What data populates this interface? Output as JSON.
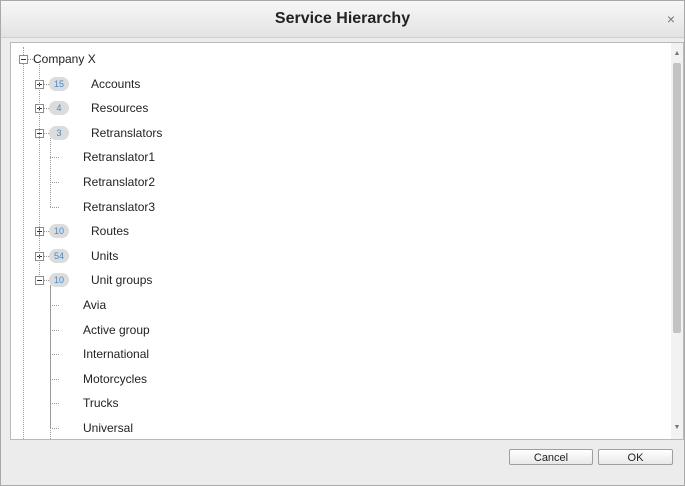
{
  "dialog": {
    "title": "Service Hierarchy",
    "close_label": "×"
  },
  "tree": {
    "root": {
      "label": "Company X",
      "expanded": true
    },
    "groups": [
      {
        "label": "Accounts",
        "count": "15",
        "expanded": false,
        "children": []
      },
      {
        "label": "Resources",
        "count": "4",
        "expanded": false,
        "children": []
      },
      {
        "label": "Retranslators",
        "count": "3",
        "expanded": true,
        "children": [
          "Retranslator1",
          "Retranslator2",
          "Retranslator3"
        ]
      },
      {
        "label": "Routes",
        "count": "10",
        "expanded": false,
        "children": []
      },
      {
        "label": "Units",
        "count": "54",
        "expanded": false,
        "children": []
      },
      {
        "label": "Unit groups",
        "count": "10",
        "expanded": true,
        "children": [
          "Avia",
          "Active group",
          "International",
          "Motorcycles",
          "Trucks",
          "Universal"
        ]
      }
    ]
  },
  "scrollbar": {
    "up_arrow": "▲",
    "down_arrow": "▼"
  },
  "buttons": {
    "cancel": "Cancel",
    "ok": "OK"
  },
  "colors": {
    "badge_text": "#3d8bd1",
    "badge_bg": "#dcdcdc"
  }
}
